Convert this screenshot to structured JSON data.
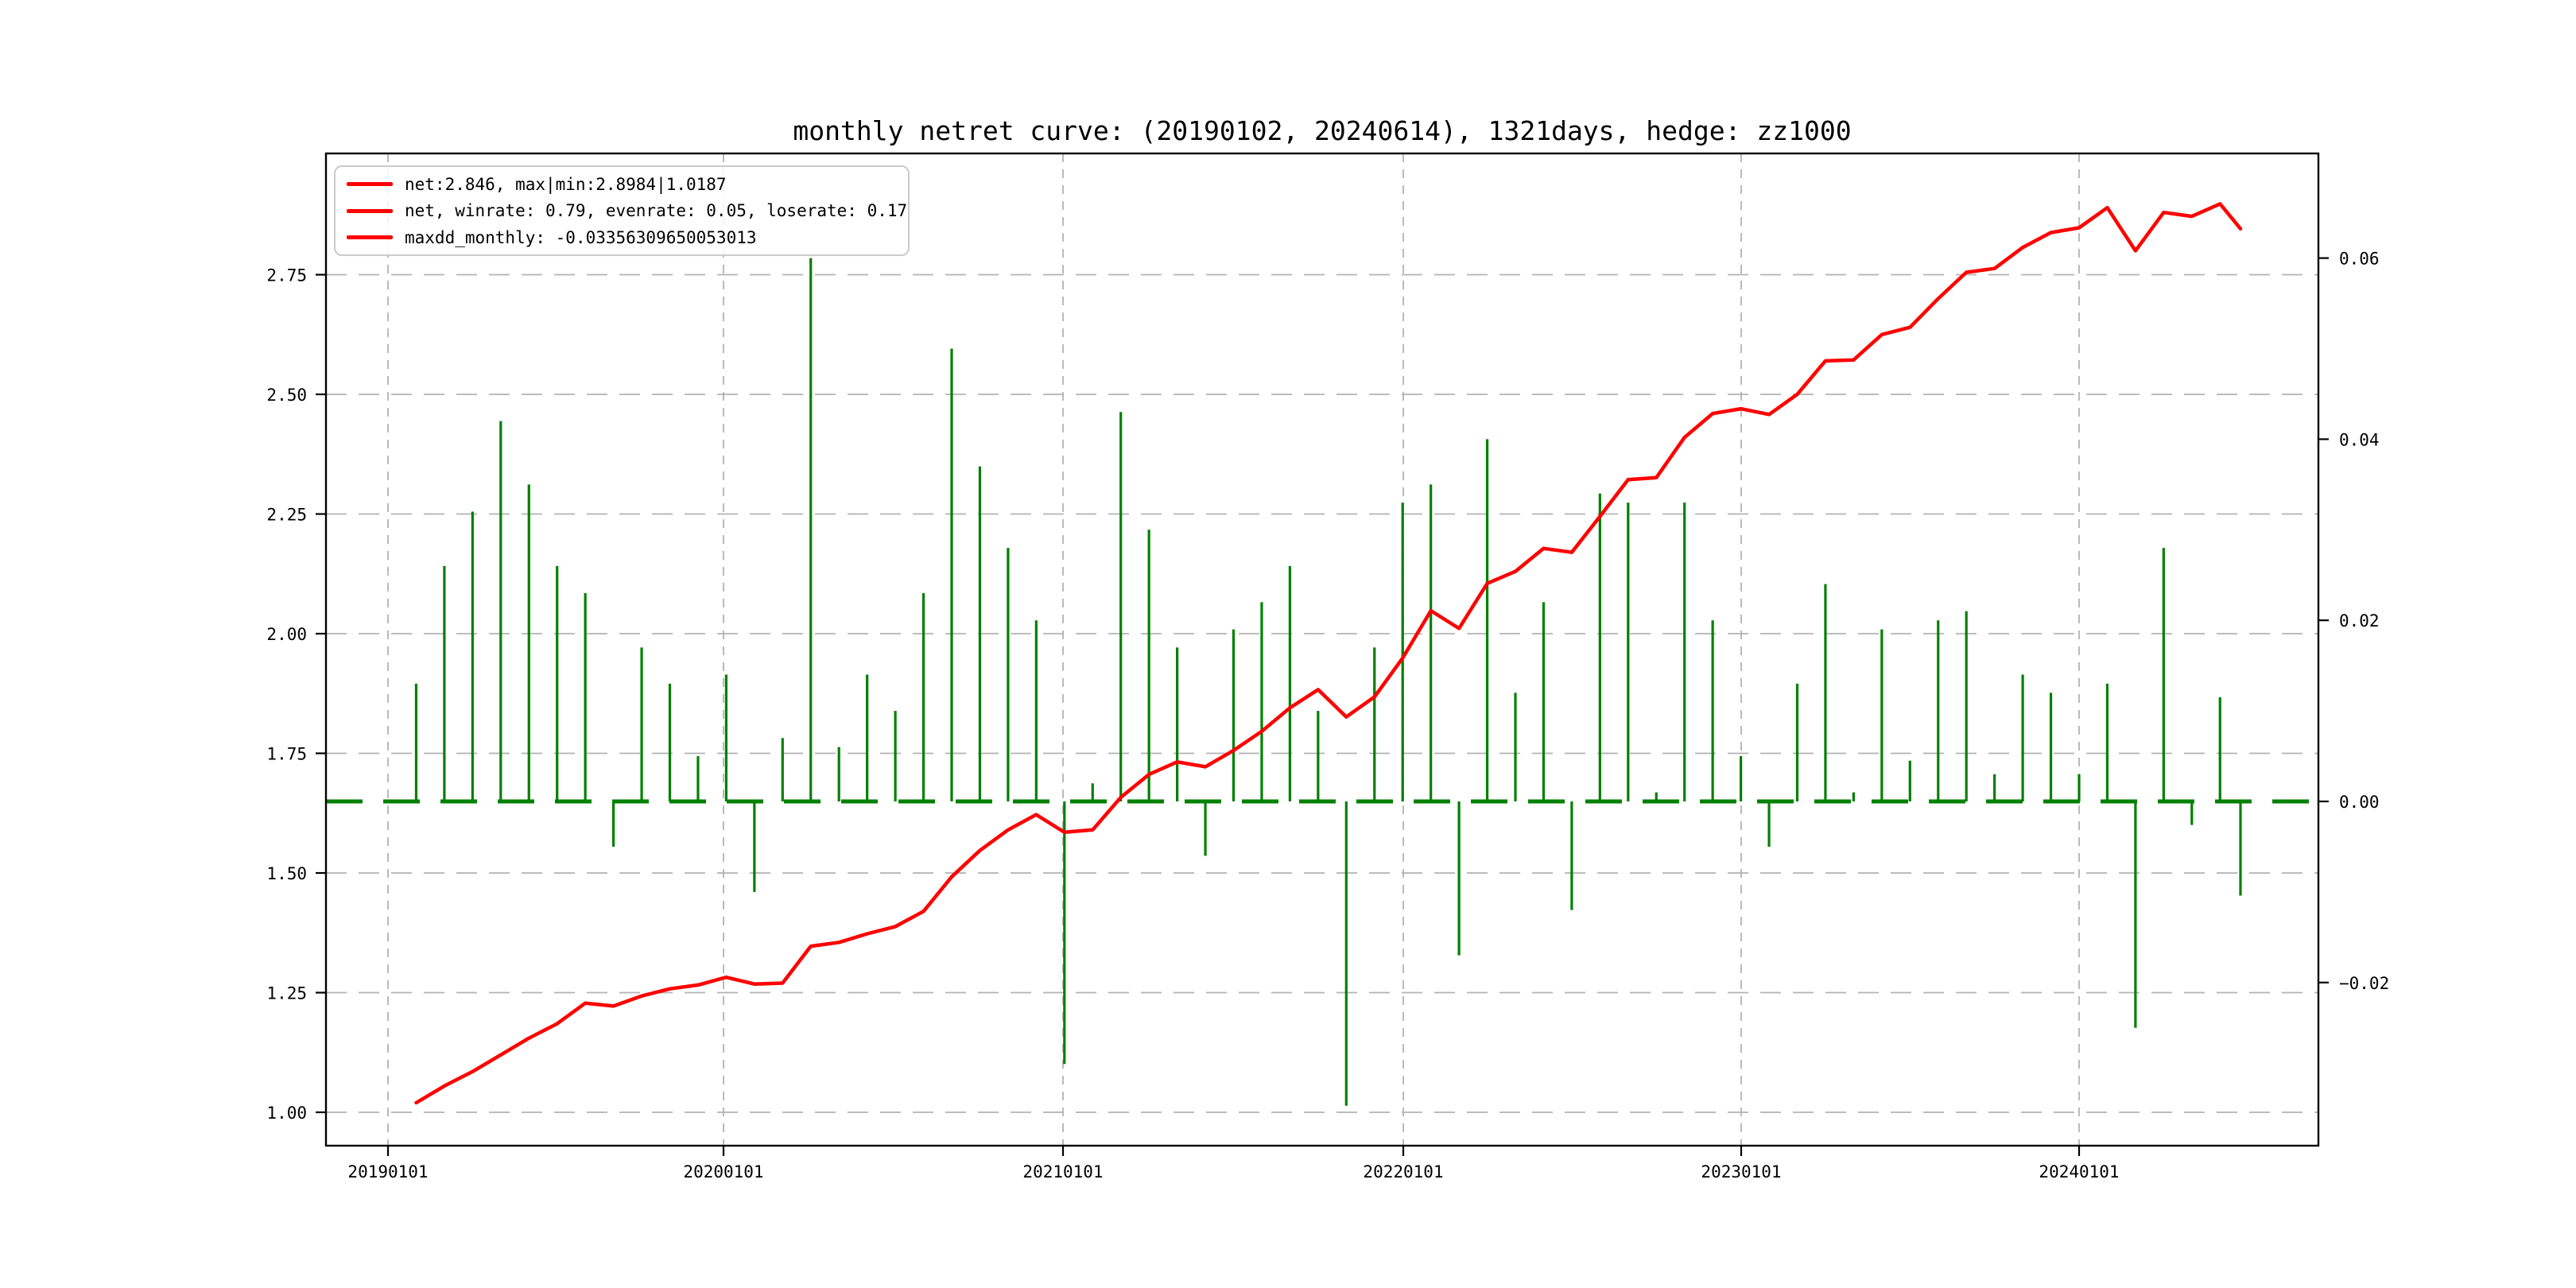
{
  "title": "monthly netret curve: (20190102, 20240614), 1321days, hedge: zz1000",
  "legend": {
    "items": [
      {
        "label": "net:2.846, max|min:2.8984|1.0187"
      },
      {
        "label": "net, winrate: 0.79, evenrate: 0.05, loserate: 0.17"
      },
      {
        "label": "maxdd_monthly: -0.03356309650053013"
      }
    ]
  },
  "colors": {
    "net_line": "#ff0000",
    "return_bar": "#008000",
    "zero_line": "#008000",
    "grid": "#b3b3b3",
    "spine": "#000000",
    "legend_border": "#cbcbcb"
  },
  "chart_data": {
    "type": "line+bar",
    "title": "monthly netret curve: (20190102, 20240614), 1321days, hedge: zz1000",
    "x_months": [
      "2019-01",
      "2019-02",
      "2019-03",
      "2019-04",
      "2019-05",
      "2019-06",
      "2019-07",
      "2019-08",
      "2019-09",
      "2019-10",
      "2019-11",
      "2019-12",
      "2020-01",
      "2020-02",
      "2020-03",
      "2020-04",
      "2020-05",
      "2020-06",
      "2020-07",
      "2020-08",
      "2020-09",
      "2020-10",
      "2020-11",
      "2020-12",
      "2021-01",
      "2021-02",
      "2021-03",
      "2021-04",
      "2021-05",
      "2021-06",
      "2021-07",
      "2021-08",
      "2021-09",
      "2021-10",
      "2021-11",
      "2021-12",
      "2022-01",
      "2022-02",
      "2022-03",
      "2022-04",
      "2022-05",
      "2022-06",
      "2022-07",
      "2022-08",
      "2022-09",
      "2022-10",
      "2022-11",
      "2022-12",
      "2023-01",
      "2023-02",
      "2023-03",
      "2023-04",
      "2023-05",
      "2023-06",
      "2023-07",
      "2023-08",
      "2023-09",
      "2023-10",
      "2023-11",
      "2023-12",
      "2024-01",
      "2024-02",
      "2024-03",
      "2024-04",
      "2024-05",
      "2024-06"
    ],
    "series": [
      {
        "name": "net cumulative curve",
        "axis": "left",
        "color": "#ff0000",
        "values": [
          1.02,
          1.055,
          1.085,
          1.12,
          1.155,
          1.185,
          1.228,
          1.222,
          1.243,
          1.258,
          1.266,
          1.282,
          1.268,
          1.27,
          1.347,
          1.355,
          1.373,
          1.388,
          1.42,
          1.492,
          1.547,
          1.59,
          1.622,
          1.585,
          1.59,
          1.658,
          1.706,
          1.732,
          1.722,
          1.756,
          1.796,
          1.845,
          1.883,
          1.826,
          1.868,
          1.949,
          2.048,
          2.011,
          2.105,
          2.13,
          2.178,
          2.17,
          2.245,
          2.322,
          2.326,
          2.41,
          2.46,
          2.47,
          2.458,
          2.5,
          2.57,
          2.572,
          2.625,
          2.64,
          2.7,
          2.755,
          2.763,
          2.807,
          2.838,
          2.848,
          2.89,
          2.8,
          2.88,
          2.872,
          2.898,
          2.846
        ]
      },
      {
        "name": "monthly return bars",
        "axis": "right",
        "color": "#008000",
        "values": [
          0.013,
          0.026,
          0.032,
          0.042,
          0.035,
          0.026,
          0.023,
          -0.005,
          0.017,
          0.013,
          0.005,
          0.014,
          -0.01,
          0.007,
          0.06,
          0.006,
          0.014,
          0.01,
          0.023,
          0.05,
          0.037,
          0.028,
          0.02,
          -0.029,
          0.002,
          0.043,
          0.03,
          0.017,
          -0.006,
          0.019,
          0.022,
          0.026,
          0.01,
          -0.0336,
          0.017,
          0.033,
          0.035,
          -0.017,
          0.04,
          0.012,
          0.022,
          -0.012,
          0.034,
          0.033,
          0.001,
          0.033,
          0.02,
          0.005,
          -0.005,
          0.013,
          0.024,
          0.001,
          0.019,
          0.0045,
          0.02,
          0.021,
          0.003,
          0.014,
          0.012,
          0.003,
          0.013,
          -0.025,
          0.028,
          -0.0026,
          0.0115,
          -0.0104
        ]
      }
    ],
    "left_axis": {
      "ticks": [
        2.75,
        2.5,
        2.25,
        2.0,
        1.75,
        1.5,
        1.25,
        1.0
      ],
      "tick_labels": [
        "2.75",
        "2.50",
        "2.25",
        "2.00",
        "1.75",
        "1.50",
        "1.25",
        "1.00"
      ],
      "lim": [
        0.93,
        3.01
      ]
    },
    "right_axis": {
      "ticks": [
        0.06,
        0.04,
        0.02,
        0.0,
        -0.02
      ],
      "tick_labels": [
        "0.06",
        "0.04",
        "0.02",
        "0.00",
        "−0.02"
      ],
      "lim": [
        -0.0379,
        0.0716
      ]
    },
    "x_axis": {
      "tick_labels": [
        "20190101",
        "20200101",
        "20210101",
        "20220101",
        "20230101",
        "20240101"
      ]
    },
    "zero_line": 0.0,
    "grid": true,
    "legend_position": "upper left"
  }
}
